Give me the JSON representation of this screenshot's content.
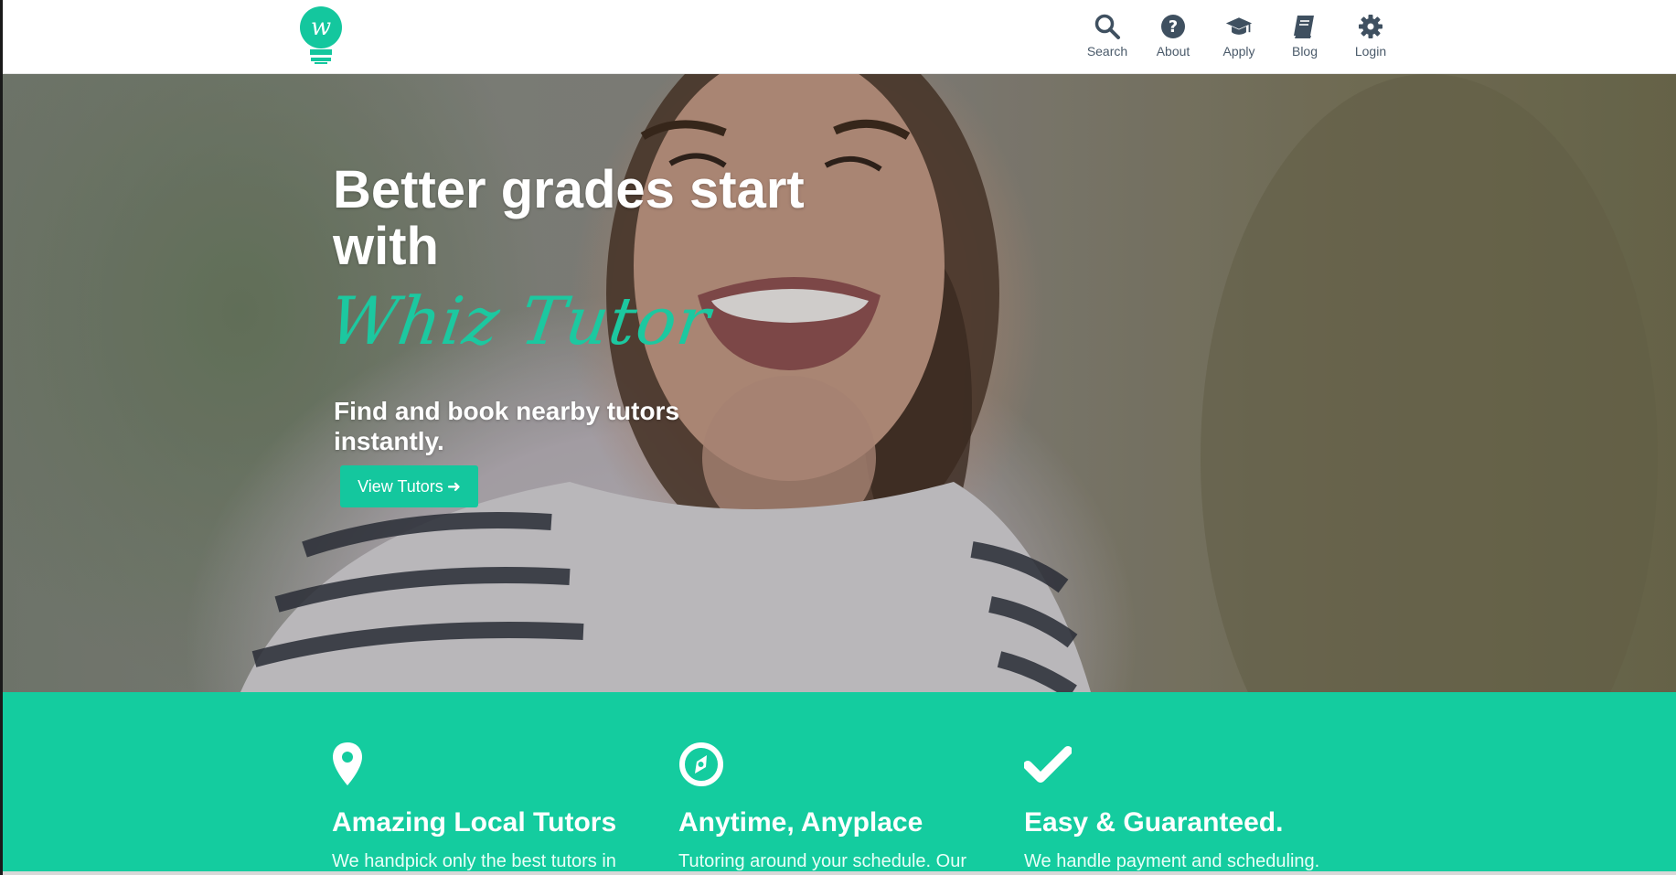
{
  "header": {
    "nav": [
      {
        "label": "Search",
        "icon": "search-icon"
      },
      {
        "label": "About",
        "icon": "question-circle-icon"
      },
      {
        "label": "Apply",
        "icon": "graduation-cap-icon"
      },
      {
        "label": "Blog",
        "icon": "book-icon"
      },
      {
        "label": "Login",
        "icon": "gear-icon"
      }
    ]
  },
  "hero": {
    "title": "Better grades start with",
    "brand": "Whiz Tutor",
    "subtitle": "Find and book nearby tutors instantly.",
    "cta_label": "View Tutors"
  },
  "features": [
    {
      "icon": "map-pin-icon",
      "title": "Amazing Local Tutors",
      "text": "We handpick only the best tutors in"
    },
    {
      "icon": "compass-icon",
      "title": "Anytime, Anyplace",
      "text": "Tutoring around your schedule. Our"
    },
    {
      "icon": "checkmark-icon",
      "title": "Easy & Guaranteed.",
      "text": "We handle payment and scheduling."
    }
  ],
  "colors": {
    "brand": "#14cc9f",
    "nav_text": "#4a5a6a",
    "white": "#ffffff"
  }
}
